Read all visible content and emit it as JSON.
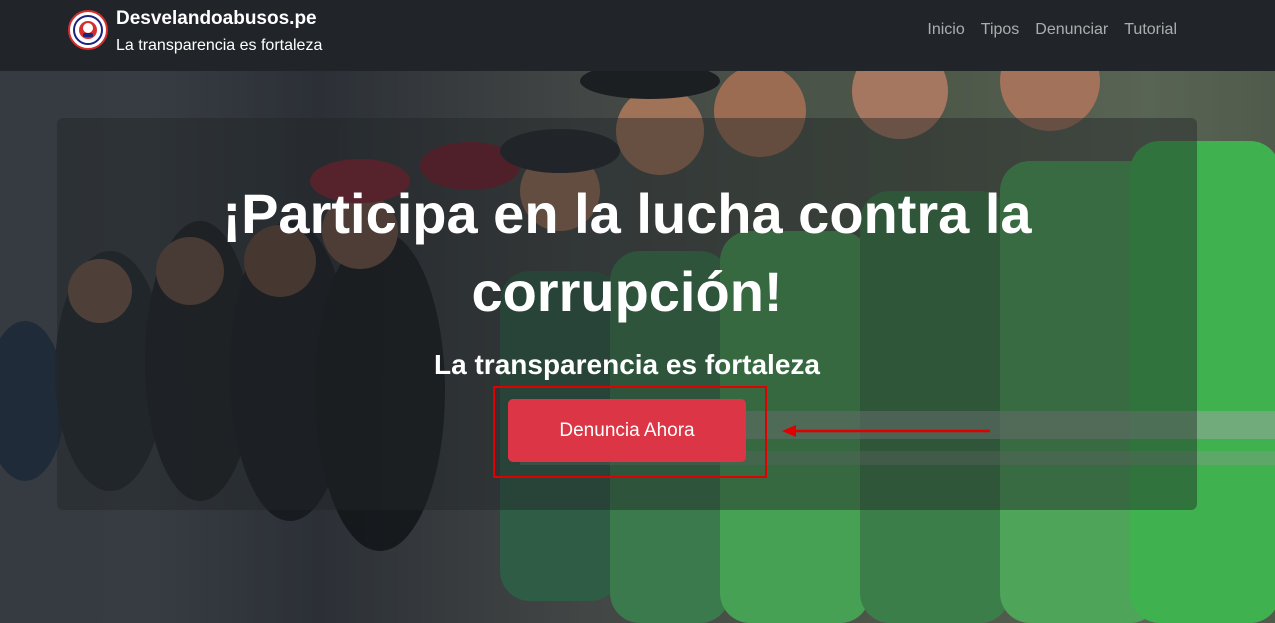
{
  "navbar": {
    "brand_title": "Desvelandoabusos.pe",
    "brand_subtitle": "La transparencia es fortaleza",
    "links": [
      "Inicio",
      "Tipos",
      "Denunciar",
      "Tutorial"
    ]
  },
  "hero": {
    "headline_line1": "¡Participa en la lucha contra la",
    "headline_line2": "corrupción!",
    "tagline": "La transparencia es fortaleza",
    "cta_label": "Denuncia Ahora"
  },
  "colors": {
    "navbar_bg": "#212529",
    "cta_bg": "#dc3545",
    "annotation": "#e00000"
  },
  "icons": [
    "logo-icon",
    "annotation-arrow-icon"
  ]
}
